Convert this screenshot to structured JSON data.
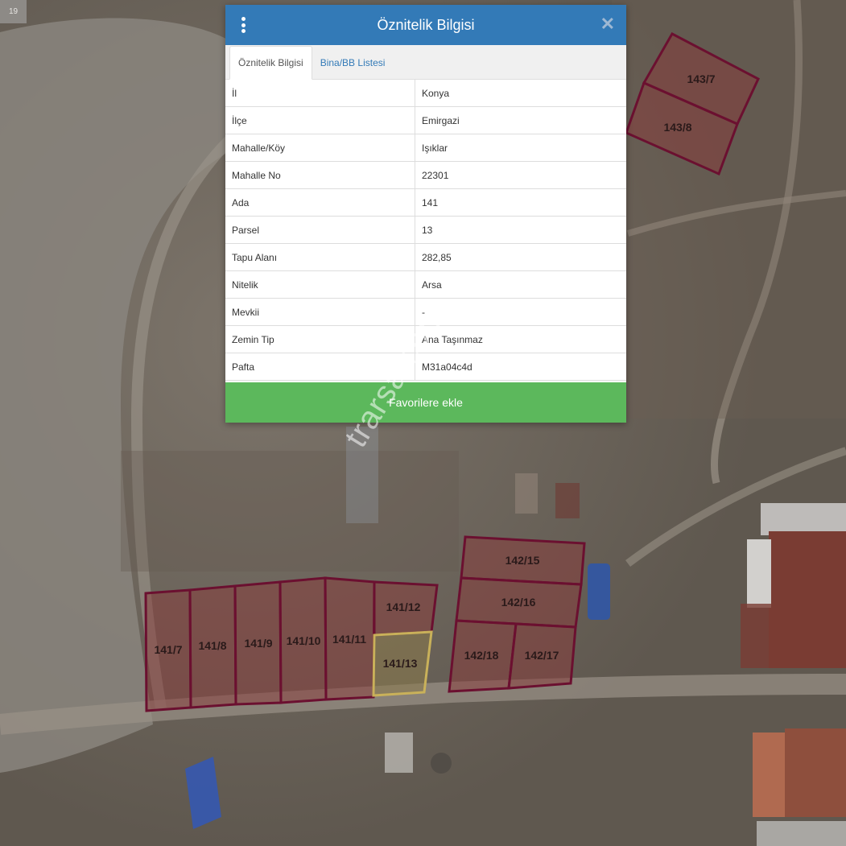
{
  "map": {
    "zoom_level": "19",
    "watermark": "trarsa.com.",
    "parcels": [
      {
        "label": "143/7",
        "selected": false
      },
      {
        "label": "143/8",
        "selected": false
      },
      {
        "label": "141/7",
        "selected": false
      },
      {
        "label": "141/8",
        "selected": false
      },
      {
        "label": "141/9",
        "selected": false
      },
      {
        "label": "141/10",
        "selected": false
      },
      {
        "label": "141/11",
        "selected": false
      },
      {
        "label": "141/12",
        "selected": false
      },
      {
        "label": "141/13",
        "selected": true
      },
      {
        "label": "142/15",
        "selected": false
      },
      {
        "label": "142/16",
        "selected": false
      },
      {
        "label": "142/18",
        "selected": false
      },
      {
        "label": "142/17",
        "selected": false
      }
    ],
    "colors": {
      "parcel_fill": "#8a3a3a",
      "parcel_stroke": "#6b1030",
      "selected_stroke": "#c9b15a"
    }
  },
  "panel": {
    "title": "Öznitelik Bilgisi",
    "tabs": [
      {
        "label": "Öznitelik Bilgisi",
        "active": true
      },
      {
        "label": "Bina/BB Listesi",
        "active": false
      }
    ],
    "rows": [
      {
        "key": "İl",
        "value": "Konya"
      },
      {
        "key": "İlçe",
        "value": "Emirgazi"
      },
      {
        "key": "Mahalle/Köy",
        "value": "Işıklar"
      },
      {
        "key": "Mahalle No",
        "value": "22301"
      },
      {
        "key": "Ada",
        "value": "141"
      },
      {
        "key": "Parsel",
        "value": "13"
      },
      {
        "key": "Tapu Alanı",
        "value": "282,85"
      },
      {
        "key": "Nitelik",
        "value": "Arsa"
      },
      {
        "key": "Mevkii",
        "value": "-"
      },
      {
        "key": "Zemin Tip",
        "value": "Ana Taşınmaz"
      },
      {
        "key": "Pafta",
        "value": "M31a04c4d"
      }
    ],
    "favorite_button": "Favorilere ekle",
    "colors": {
      "header": "#337ab7",
      "button": "#5cb85c"
    }
  }
}
